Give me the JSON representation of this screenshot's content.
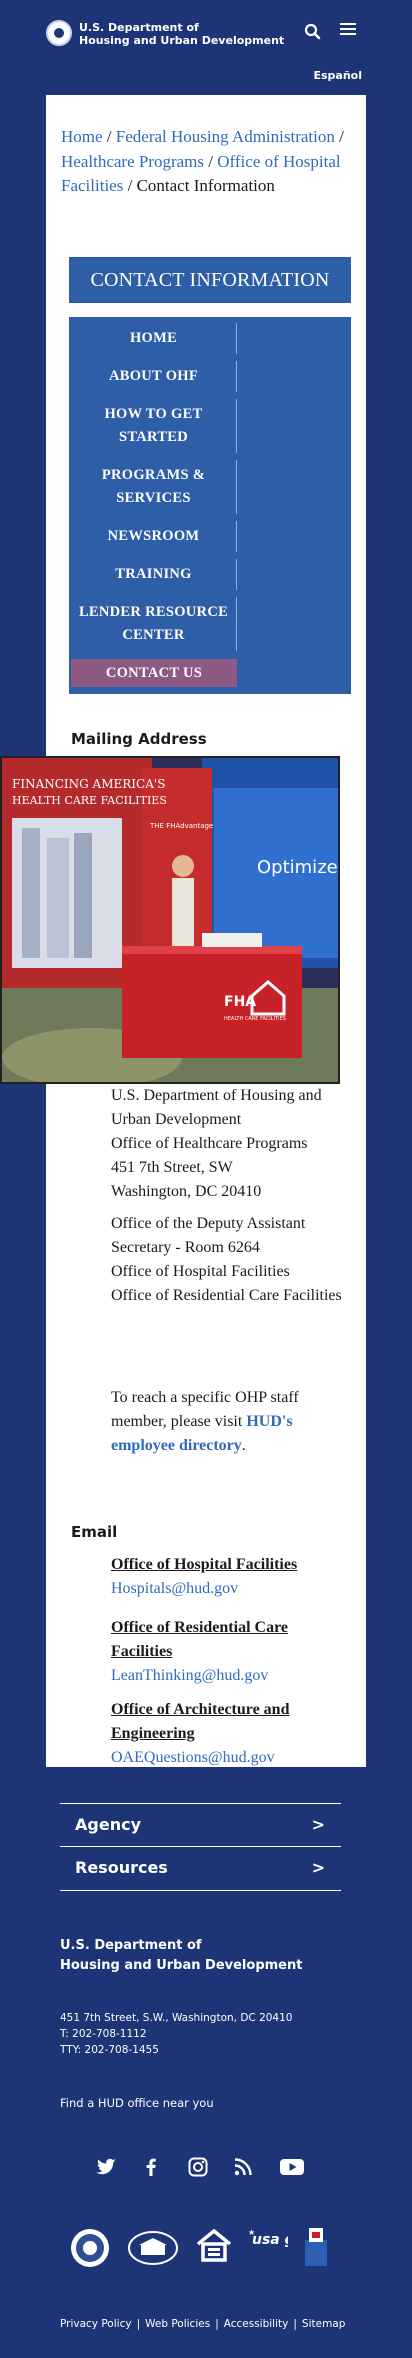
{
  "header": {
    "agency_line1": "U.S. Department of",
    "agency_line2": "Housing and Urban Development",
    "language_link": "Español"
  },
  "breadcrumb": {
    "items": [
      "Home",
      "Federal Housing Administration",
      "Healthcare Programs",
      "Office of Hospital Facilities"
    ],
    "current": "Contact Information",
    "separator": "/"
  },
  "contact_title": "CONTACT INFORMATION",
  "side_nav": {
    "items": [
      {
        "label": "HOME"
      },
      {
        "label": "ABOUT OHF"
      },
      {
        "label": "HOW TO GET STARTED"
      },
      {
        "label": "PROGRAMS & SERVICES"
      },
      {
        "label": "NEWSROOM"
      },
      {
        "label": "TRAINING"
      },
      {
        "label": "LENDER RESOURCE CENTER"
      },
      {
        "label": "CONTACT US"
      }
    ]
  },
  "mailing": {
    "heading": "Mailing Address",
    "address1": [
      "U.S. Department of Housing and Urban Development",
      "Office of Healthcare Programs",
      "451 7th Street, SW",
      "Washington, DC 20410"
    ],
    "address2": [
      "Office of the Deputy Assistant Secretary - Room 6264",
      "Office of Hospital Facilities",
      "Office of Residential Care Facilities"
    ],
    "staff_text": "To reach a specific OHP staff member, please visit ",
    "staff_link": "HUD's employee directory",
    "staff_end": "."
  },
  "photo": {
    "banner_text1": "FINANCING AMERICA'S",
    "banner_text2": "HEALTH CARE FACILITIES",
    "panel_title": "THE FHAdvantage",
    "optimize_text": "Optimize",
    "table_logo": "FHA",
    "table_sub": "HEALTH CARE FACILITIES"
  },
  "email": {
    "heading": "Email",
    "entries": [
      {
        "title": "Office of Hospital Facilities",
        "address": "Hospitals@hud.gov"
      },
      {
        "title": "Office of Residential Care Facilities",
        "address": "LeanThinking@hud.gov"
      },
      {
        "title": "Office of Architecture and Engineering",
        "address": "OAEQuestions@hud.gov"
      }
    ]
  },
  "footer": {
    "accordion": [
      "Agency",
      "Resources"
    ],
    "name_line1": "U.S. Department of",
    "name_line2": "Housing and Urban Development",
    "street": "451 7th Street, S.W., Washington, DC 20410",
    "phone": "T: 202-708-1112",
    "tty": "TTY: 202-708-1455",
    "find_office": "Find a HUD office near you",
    "social_icons": [
      "twitter-icon",
      "facebook-icon",
      "instagram-icon",
      "rss-icon",
      "youtube-icon"
    ],
    "badges": [
      "hud-seal",
      "white-house-logo",
      "equal-housing-logo",
      "usa-gov-logo",
      "vote-logo"
    ],
    "usagov_text": "usa gov",
    "links": [
      "Privacy Policy",
      "Web Policies",
      "Accessibility",
      "Sitemap"
    ]
  },
  "colors": {
    "navy": "#1d3577",
    "blue": "#2f5ea8",
    "link": "#2f6bbd",
    "active_nav": "#8d5a83"
  }
}
